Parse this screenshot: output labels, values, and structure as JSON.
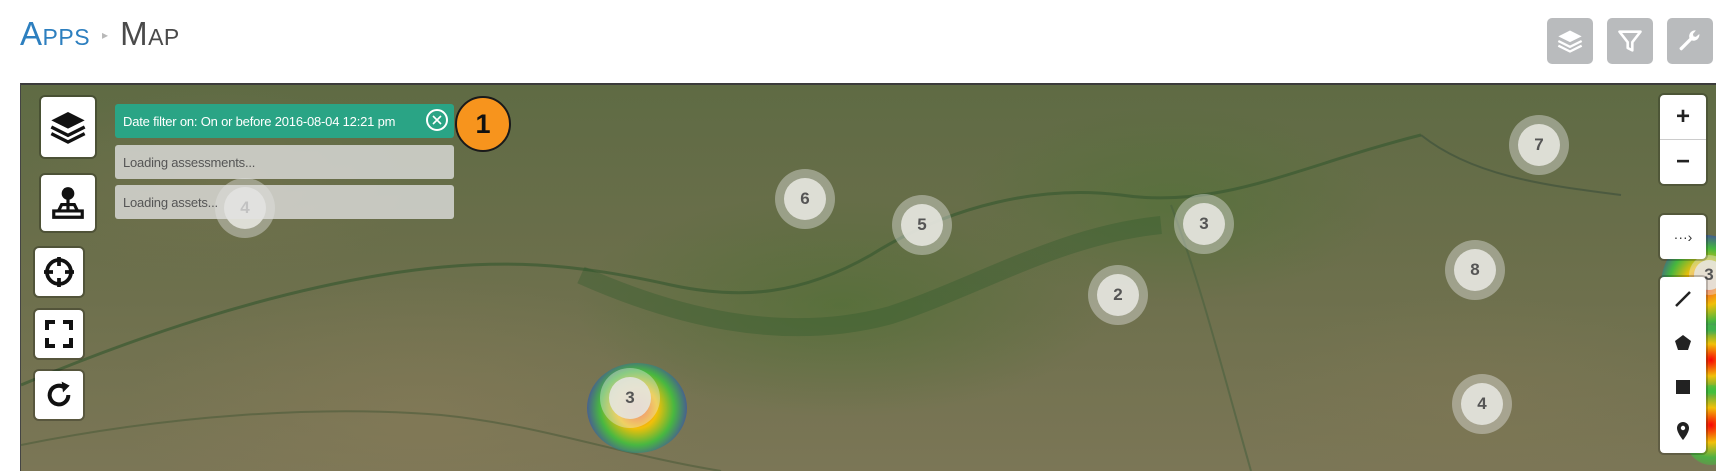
{
  "breadcrumb": {
    "parent": "Apps",
    "separator": "▸",
    "current": "Map"
  },
  "top_tools": [
    {
      "icon": "layers-icon"
    },
    {
      "icon": "filter-icon"
    },
    {
      "icon": "wrench-icon"
    }
  ],
  "left_controls": [
    {
      "icon": "layers-icon"
    },
    {
      "icon": "joystick-icon"
    },
    {
      "icon": "crosshair-icon"
    },
    {
      "icon": "fullscreen-icon"
    },
    {
      "icon": "refresh-icon"
    }
  ],
  "filters": {
    "date_filter": "Date filter on: On or before 2016-08-04 12:21 pm",
    "loading_assessments": "Loading assessments...",
    "loading_assets": "Loading assets..."
  },
  "badge": {
    "label": "1",
    "color": "#f7941d"
  },
  "clusters": [
    {
      "count": "4"
    },
    {
      "count": "6"
    },
    {
      "count": "5"
    },
    {
      "count": "3"
    },
    {
      "count": "2"
    },
    {
      "count": "7"
    },
    {
      "count": "8"
    },
    {
      "count": "3"
    },
    {
      "count": "4"
    },
    {
      "count": "3"
    }
  ],
  "zoom": {
    "in": "+",
    "out": "−"
  },
  "expand_label": "···›",
  "draw_tools": [
    {
      "icon": "line-icon"
    },
    {
      "icon": "polygon-icon"
    },
    {
      "icon": "rectangle-icon"
    },
    {
      "icon": "marker-icon"
    }
  ],
  "colors": {
    "link": "#2d7fbf",
    "filter_active": "#2aa485",
    "badge": "#f7941d",
    "tool_button": "#b9bbbd"
  }
}
